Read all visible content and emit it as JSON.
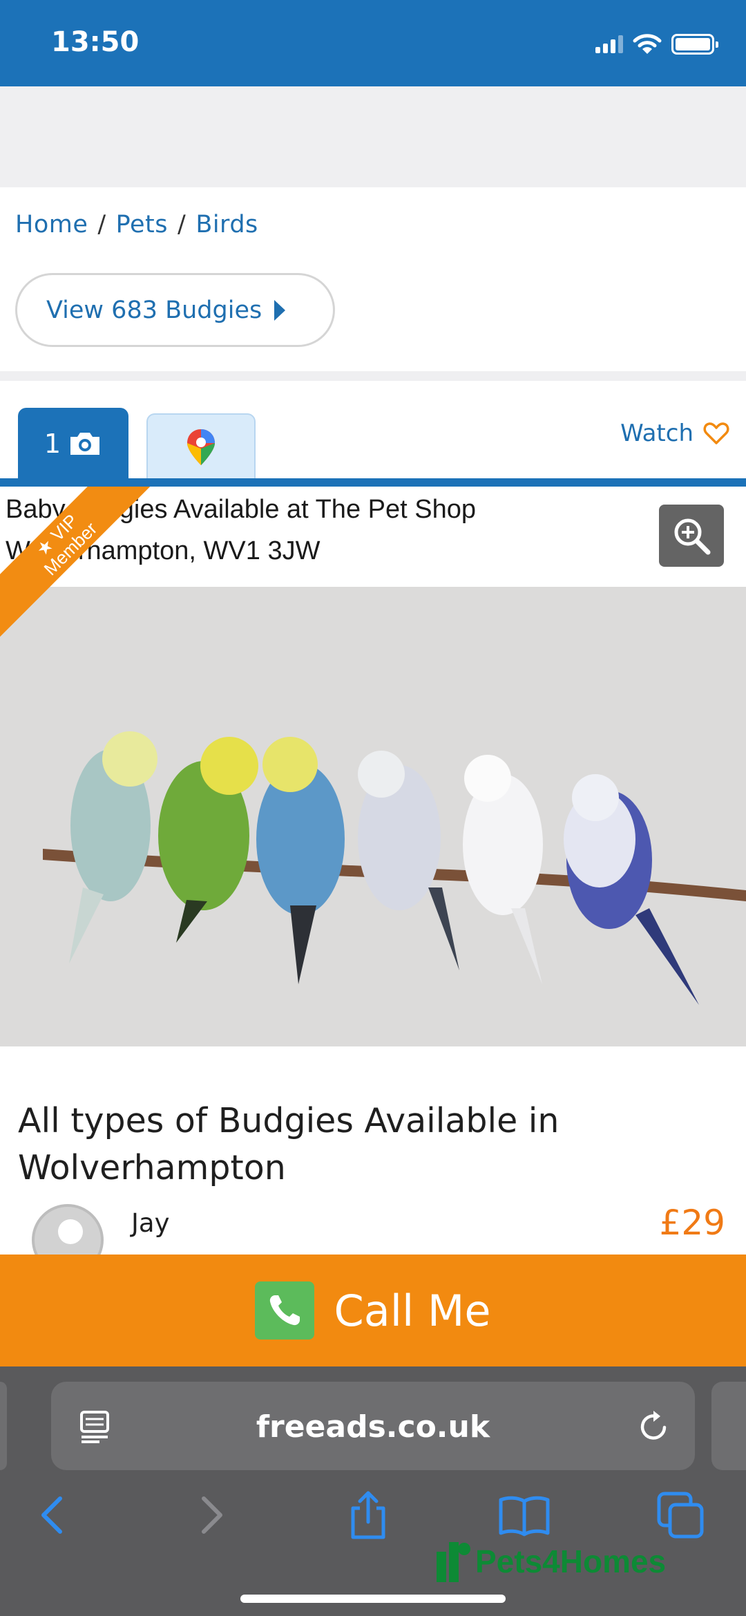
{
  "status_bar": {
    "time": "13:50"
  },
  "breadcrumb": {
    "items": [
      "Home",
      "Pets",
      "Birds"
    ],
    "separator": "/"
  },
  "view_button": {
    "label": "View 683 Budgies"
  },
  "tabs": {
    "photo_count": "1",
    "watch_label": "Watch"
  },
  "photo": {
    "caption_line1": "Baby Budgies Available at The Pet Shop",
    "caption_line2": "Wolverhampton, WV1 3JW",
    "vip_line1": "★ VIP",
    "vip_line2": "Member"
  },
  "listing": {
    "title": "All types of Budgies Available in Wolverhampton",
    "seller_name": "Jay",
    "price": "£29"
  },
  "call_button": {
    "label": "Call Me"
  },
  "browser": {
    "url": "freeads.co.uk"
  },
  "watermark": {
    "text": "Pets4Homes"
  },
  "colors": {
    "brand_blue": "#1c72b8",
    "link_blue": "#1f6fb0",
    "orange": "#f28a10",
    "price_orange": "#f07a15",
    "call_green": "#5cbb5b"
  },
  "icons": [
    "signal-icon",
    "wifi-icon",
    "battery-icon",
    "camera-icon",
    "map-pin-icon",
    "heart-icon",
    "zoom-icon",
    "phone-icon",
    "reader-icon",
    "reload-icon",
    "back-icon",
    "forward-icon",
    "share-icon",
    "bookmarks-icon",
    "tabs-icon"
  ]
}
